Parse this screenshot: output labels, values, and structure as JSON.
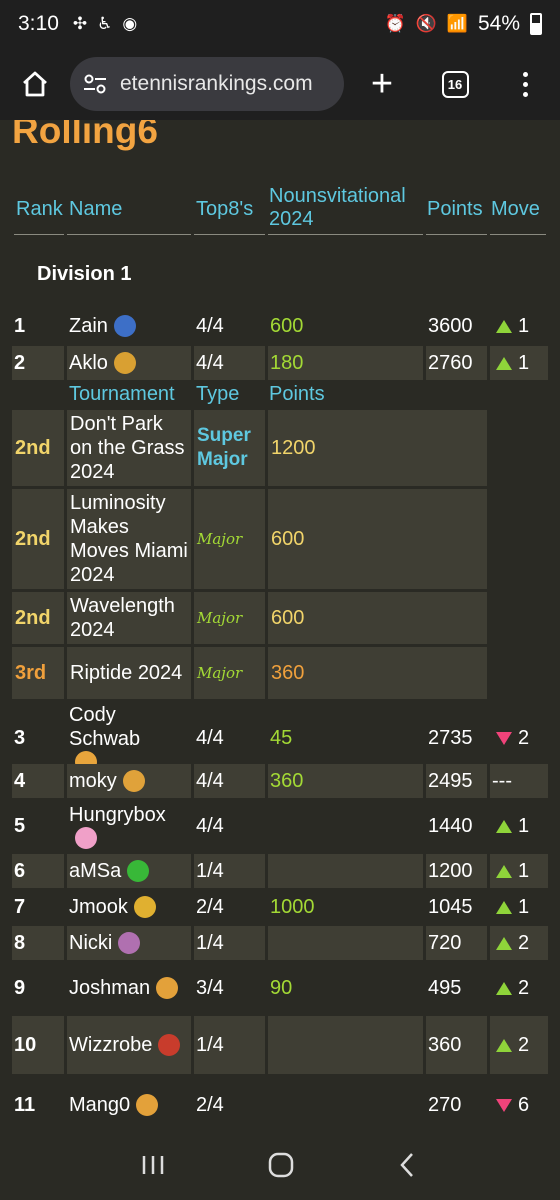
{
  "status": {
    "time": "3:10",
    "battery": "54%"
  },
  "browser": {
    "url": "etennisrankings.com",
    "tab_count": "16"
  },
  "page": {
    "title": "Rolling6",
    "headers": {
      "rank": "Rank",
      "name": "Name",
      "top8": "Top8's",
      "nouns": "Nounsvitational 2024",
      "points": "Points",
      "move": "Move"
    },
    "division": "Division 1",
    "subtable_headers": {
      "tournament": "Tournament",
      "type": "Type",
      "points": "Points"
    },
    "subtable": [
      {
        "placing": "2nd",
        "tournament": "Don't Park on the Grass 2024",
        "type": "Super Major",
        "points": "1200"
      },
      {
        "placing": "2nd",
        "tournament": "Luminosity Makes Moves Miami 2024",
        "type": "Major",
        "points": "600"
      },
      {
        "placing": "2nd",
        "tournament": "Wavelength 2024",
        "type": "Major",
        "points": "600"
      },
      {
        "placing": "3rd",
        "tournament": "Riptide 2024",
        "type": "Major",
        "points": "360"
      }
    ],
    "rows": [
      {
        "rank": "1",
        "name": "Zain",
        "top8": "4/4",
        "nouns": "600",
        "points": "3600",
        "move_dir": "up",
        "move": "1"
      },
      {
        "rank": "2",
        "name": "Aklo",
        "top8": "4/4",
        "nouns": "180",
        "points": "2760",
        "move_dir": "up",
        "move": "1"
      },
      {
        "rank": "3",
        "name": "Cody Schwab",
        "top8": "4/4",
        "nouns": "45",
        "points": "2735",
        "move_dir": "down",
        "move": "2"
      },
      {
        "rank": "4",
        "name": "moky",
        "top8": "4/4",
        "nouns": "360",
        "points": "2495",
        "move_dir": "none",
        "move": "---"
      },
      {
        "rank": "5",
        "name": "Hungrybox",
        "top8": "4/4",
        "nouns": "",
        "points": "1440",
        "move_dir": "up",
        "move": "1"
      },
      {
        "rank": "6",
        "name": "aMSa",
        "top8": "1/4",
        "nouns": "",
        "points": "1200",
        "move_dir": "up",
        "move": "1"
      },
      {
        "rank": "7",
        "name": "Jmook",
        "top8": "2/4",
        "nouns": "1000",
        "points": "1045",
        "move_dir": "up",
        "move": "1"
      },
      {
        "rank": "8",
        "name": "Nicki",
        "top8": "1/4",
        "nouns": "",
        "points": "720",
        "move_dir": "up",
        "move": "2"
      },
      {
        "rank": "9",
        "name": "Joshman",
        "top8": "3/4",
        "nouns": "90",
        "points": "495",
        "move_dir": "up",
        "move": "2"
      },
      {
        "rank": "10",
        "name": "Wizzrobe",
        "top8": "1/4",
        "nouns": "",
        "points": "360",
        "move_dir": "up",
        "move": "2"
      },
      {
        "rank": "11",
        "name": "Mang0",
        "top8": "2/4",
        "nouns": "",
        "points": "270",
        "move_dir": "down",
        "move": "6"
      }
    ]
  },
  "colors": {
    "title": "#f2a441",
    "header": "#5ec8e0",
    "accent_green": "#a3d935",
    "up": "#8fd43a",
    "down": "#f0437a"
  },
  "icons": [
    "home-icon",
    "tune-icon",
    "plus-icon",
    "tabs-icon",
    "more-vert-icon",
    "recents-icon",
    "home-circle-icon",
    "back-icon"
  ]
}
